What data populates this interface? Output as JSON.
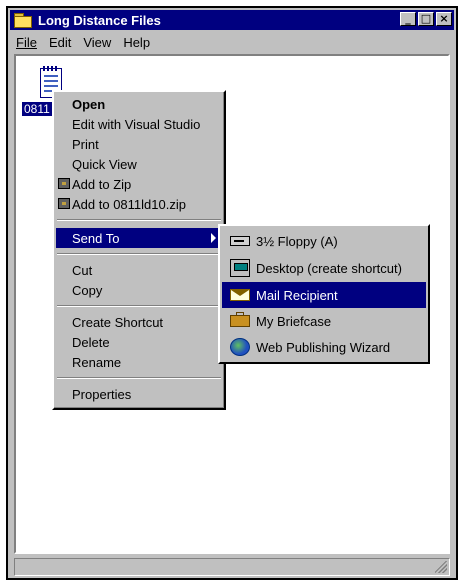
{
  "window": {
    "title": "Long Distance Files",
    "minimize_icon": "minimize-icon",
    "maximize_icon": "maximize-icon",
    "close_icon": "close-icon"
  },
  "menubar": {
    "file": "File",
    "edit": "Edit",
    "view": "View",
    "help": "Help"
  },
  "file": {
    "label": "0811",
    "icon": "notebook-icon"
  },
  "context_menu": {
    "open": "Open",
    "edit_vs": "Edit with Visual Studio",
    "print": "Print",
    "quick_view": "Quick View",
    "add_zip": "Add to Zip",
    "add_named_zip": "Add to 0811ld10.zip",
    "send_to": "Send To",
    "cut": "Cut",
    "copy": "Copy",
    "create_shortcut": "Create Shortcut",
    "delete": "Delete",
    "rename": "Rename",
    "properties": "Properties"
  },
  "send_to_menu": {
    "floppy": "3½ Floppy (A)",
    "desktop": "Desktop (create shortcut)",
    "mail": "Mail Recipient",
    "briefcase": "My Briefcase",
    "web_wizard": "Web Publishing Wizard"
  },
  "colors": {
    "titlebar": "#000080",
    "selection": "#000080",
    "face": "#c0c0c0"
  }
}
